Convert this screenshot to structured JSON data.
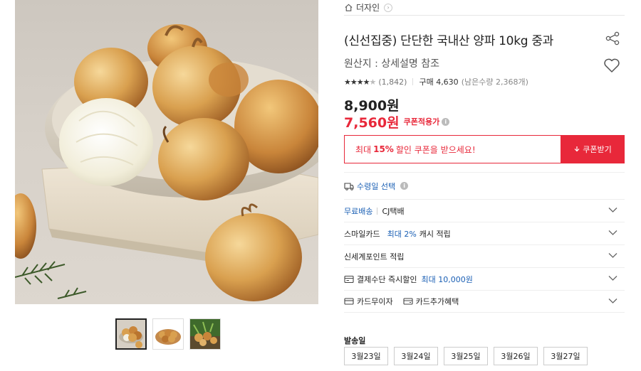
{
  "store": {
    "name": "더자인"
  },
  "product": {
    "title": "(신선집중) 단단한 국내산 양파 10kg 중과",
    "origin": "원산지 : 상세설명 참조",
    "rating_count": "(1,842)",
    "purchase": "구매 4,630",
    "remaining": "(남은수량 2,368개)",
    "price_original": "8,900원",
    "price_sale": "7,560원",
    "coupon_price_label": "쿠폰적용가"
  },
  "rating": {
    "value": 4.5,
    "max": 5
  },
  "coupon": {
    "msg_prefix": "최대",
    "percent": "15%",
    "msg_suffix": "할인 쿠폰을 받으세요!",
    "button": "쿠폰받기"
  },
  "delivery": {
    "select_label": "수령일 선택"
  },
  "options": {
    "shipping_free": "무료배송",
    "courier": "CJ택배",
    "smilecard_prefix": "스마일카드",
    "smilecard_highlight": "최대 2%",
    "smilecard_suffix": "캐시 적립",
    "shinsegae": "신세계포인트 적립",
    "instant_prefix": "결제수단 즉시할인",
    "instant_highlight": "최대 10,000원",
    "card_interest_free": "카드무이자",
    "card_extra": "카드추가혜택"
  },
  "shipping": {
    "label": "발송일",
    "dates": [
      "3월23일",
      "3월24일",
      "3월25일",
      "3월26일",
      "3월27일"
    ]
  },
  "colors": {
    "accent_red": "#e8283a",
    "link_blue": "#1a5fb4"
  },
  "icons": [
    "home-icon",
    "chevron-right-icon",
    "share-icon",
    "heart-icon",
    "star-icon",
    "info-icon",
    "download-icon",
    "truck-icon",
    "chevron-down-icon",
    "receipt-icon",
    "card-icon"
  ]
}
